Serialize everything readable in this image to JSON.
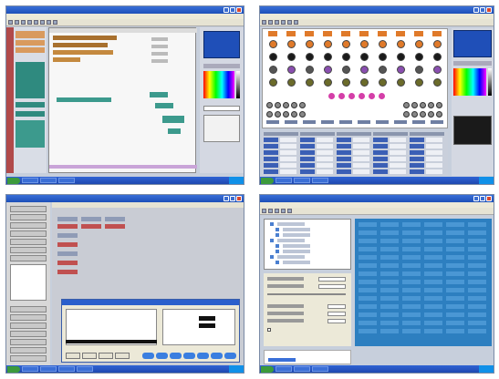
{
  "screens": [
    {
      "title": "",
      "menu": [
        "",
        "",
        "",
        "",
        "",
        "",
        ""
      ]
    },
    {
      "title": "",
      "menu": [
        "",
        "",
        "",
        "",
        "",
        "",
        ""
      ]
    },
    {
      "title": "",
      "menu": []
    },
    {
      "title": "",
      "menu": [
        "",
        "",
        "",
        "",
        "",
        ""
      ]
    }
  ],
  "taskbar": {
    "start_label": "",
    "clock": ""
  },
  "icons": {
    "close": "close-icon",
    "minimize": "minimize-icon",
    "maximize": "maximize-icon"
  },
  "colors": {
    "titlebar": "#2a5fcc",
    "teal": "#2f8a7f",
    "timeline_blue": "#1f5fa8",
    "fader_blue": "#2f5fbf",
    "grid_blue": "#2d7fc0",
    "orange": "#e07a2a",
    "magenta": "#d43fa8"
  }
}
